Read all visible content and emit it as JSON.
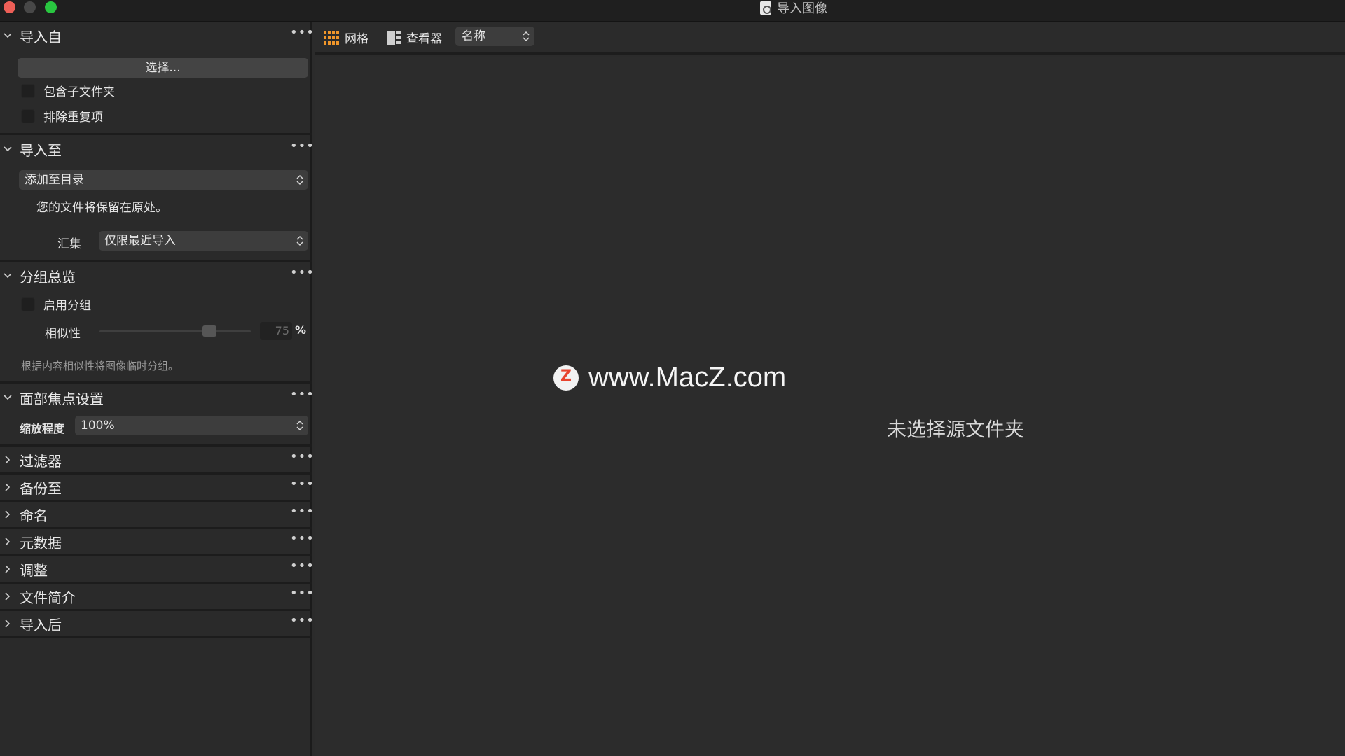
{
  "window": {
    "title": "导入图像"
  },
  "sidebar": {
    "import_from": {
      "title": "导入自",
      "choose_button": "选择...",
      "include_subfolders": "包含子文件夹",
      "exclude_duplicates": "排除重复项"
    },
    "import_to": {
      "title": "导入至",
      "destination": "添加至目录",
      "note": "您的文件将保留在原处。",
      "collection_label": "汇集",
      "collection_value": "仅限最近导入"
    },
    "grouping": {
      "title": "分组总览",
      "enable_label": "启用分组",
      "similarity_label": "相似性",
      "similarity_value": "75",
      "similarity_unit": "%",
      "hint": "根据内容相似性将图像临时分组。"
    },
    "face_focus": {
      "title": "面部焦点设置",
      "zoom_label": "缩放程度",
      "zoom_value": "100%"
    },
    "collapsed_sections": [
      "过滤器",
      "备份至",
      "命名",
      "元数据",
      "调整",
      "文件简介",
      "导入后"
    ],
    "more_glyph": "•••"
  },
  "toolbar": {
    "grid_label": "网格",
    "viewer_label": "查看器",
    "sort_value": "名称"
  },
  "main": {
    "watermark_logo": "Z",
    "watermark_text": "www.MacZ.com",
    "empty_message": "未选择源文件夹"
  },
  "colors": {
    "accent": "#f0962a",
    "close": "#ee5f57",
    "maximize": "#29c640"
  }
}
